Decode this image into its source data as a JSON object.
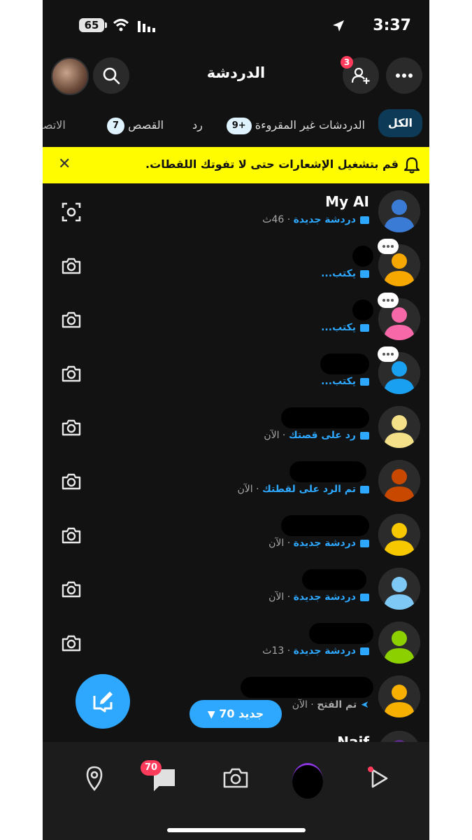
{
  "status": {
    "battery": "65",
    "time": "3:37"
  },
  "header": {
    "title": "الدردشة",
    "add_friend_badge": "3"
  },
  "tabs": [
    {
      "label": "الكل"
    },
    {
      "label": "الدردشات غير المقروءة",
      "badge": "9+"
    },
    {
      "label": "رد"
    },
    {
      "label": "القصص",
      "badge": "7"
    },
    {
      "label": "الاتصا"
    }
  ],
  "banner": {
    "text": "قم بتشغيل الإشعارات حتى لا تفوتك اللقطات."
  },
  "chats": [
    {
      "name": "My AI",
      "status": "دردشة جديدة",
      "time": "46ث",
      "avatar_color": "#3a7bd5",
      "action_icon": "scan-icon"
    },
    {
      "name": "",
      "status": "يكتب...",
      "time": "",
      "avatar_color": "#f7a800",
      "typing": true
    },
    {
      "name": "",
      "status": "يكتب...",
      "time": "",
      "avatar_color": "#f768a8",
      "typing": true
    },
    {
      "name": "",
      "status": "يكتب...",
      "time": "",
      "avatar_color": "#1aa0f0",
      "typing": true
    },
    {
      "name": "",
      "status": "رد على قصتك",
      "time": "الآن",
      "avatar_color": "#f5e08a"
    },
    {
      "name": "",
      "status": "تم الرد على لقطتك",
      "time": "الآن",
      "avatar_color": "#c84800"
    },
    {
      "name": "",
      "status": "دردشة جديدة",
      "time": "الآن",
      "avatar_color": "#f7c800"
    },
    {
      "name": "",
      "status": "دردشة جديدة",
      "time": "الآن",
      "avatar_color": "#7ec8f5"
    },
    {
      "name": "",
      "status": "دردشة جديدة",
      "time": "13ث",
      "avatar_color": "#8cd000"
    },
    {
      "name": "",
      "status": "تم الفتح",
      "time": "الآن",
      "avatar_color": "#f7b000",
      "sent": true
    },
    {
      "name": "Naif",
      "status": "",
      "time": "",
      "avatar_color": "#5b2a86"
    }
  ],
  "new_pill": {
    "label": "جديد 70"
  },
  "nav": {
    "chat_badge": "70"
  },
  "colors": {
    "accent": "#2ea8ff",
    "banner": "#fffc00",
    "badge": "#ff3b5c"
  }
}
